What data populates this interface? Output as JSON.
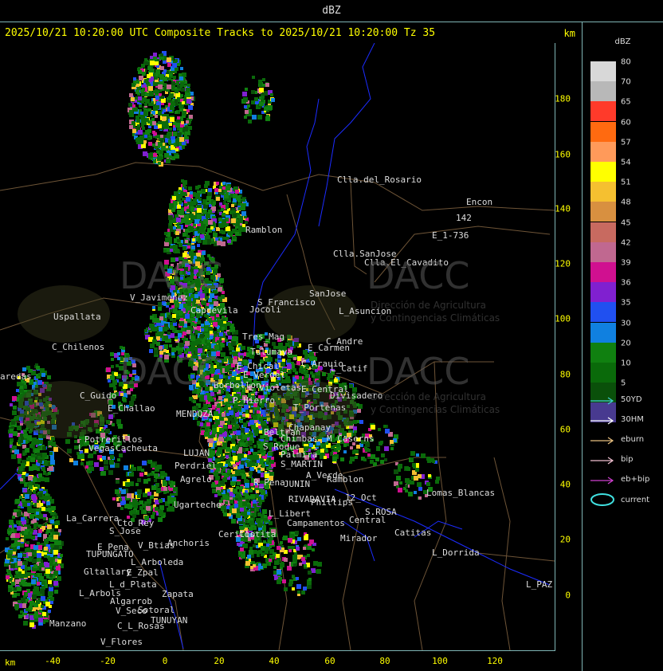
{
  "title_bar": "dBZ",
  "header": {
    "text": "2025/10/21 10:20:00 UTC Composite Tracks to 2025/10/21 10:20:00 Tz 35",
    "unit": "km"
  },
  "y_axis": {
    "unit": "km",
    "ticks": [
      "180",
      "160",
      "140",
      "120",
      "100",
      "80",
      "60",
      "40",
      "20",
      "0"
    ]
  },
  "x_axis": {
    "unit": "km",
    "ticks": [
      "-40",
      "-20",
      "0",
      "20",
      "40",
      "60",
      "80",
      "100",
      "120"
    ]
  },
  "legend": {
    "title": "dBZ",
    "levels": [
      {
        "label": "80",
        "color": "#d8d8d8"
      },
      {
        "label": "70",
        "color": "#b8b8b8"
      },
      {
        "label": "65",
        "color": "#ff3a2a"
      },
      {
        "label": "60",
        "color": "#ff6a10"
      },
      {
        "label": "57",
        "color": "#ff9a5a"
      },
      {
        "label": "54",
        "color": "#ffff00"
      },
      {
        "label": "51",
        "color": "#f5c030"
      },
      {
        "label": "48",
        "color": "#d89040"
      },
      {
        "label": "45",
        "color": "#c86a60"
      },
      {
        "label": "42",
        "color": "#c06890"
      },
      {
        "label": "39",
        "color": "#d01090"
      },
      {
        "label": "36",
        "color": "#8020d0"
      },
      {
        "label": "35",
        "color": "#2050f0"
      },
      {
        "label": "30",
        "color": "#1080e0"
      },
      {
        "label": "20",
        "color": "#108010"
      },
      {
        "label": "10",
        "color": "#0a6a0a"
      },
      {
        "label": "5",
        "color": "#0a500a"
      },
      {
        "label": "",
        "color": "#483a90"
      }
    ],
    "tracks": [
      {
        "label": "50YD",
        "color": "#40d0d0"
      },
      {
        "label": "30HM",
        "color": "#ffffff"
      },
      {
        "label": "eburn",
        "color": "#e8c080"
      },
      {
        "label": "bip",
        "color": "#f0c0d0"
      },
      {
        "label": "eb+bip",
        "color": "#d040d0"
      }
    ],
    "current_label": "current",
    "current_color": "#40e0e0"
  },
  "watermark": {
    "brand": "DACC",
    "line1": "Dirección de Agricultura",
    "line2": "y Contingencias Climáticas"
  },
  "places": [
    {
      "name": "Clla.del_Rosario"
    },
    {
      "name": "Encon"
    },
    {
      "name": "142"
    },
    {
      "name": "E_1-736"
    },
    {
      "name": "Ramblon"
    },
    {
      "name": "Clla.SanJose"
    },
    {
      "name": "Clla.El_Cavadito"
    },
    {
      "name": "Uspallata"
    },
    {
      "name": "V_Javimenez"
    },
    {
      "name": "Capdevila"
    },
    {
      "name": "S_Francisco"
    },
    {
      "name": "SanJose"
    },
    {
      "name": "L_Asuncion"
    },
    {
      "name": "C_Chilenos"
    },
    {
      "name": "Tres_Mag"
    },
    {
      "name": "Jocoli"
    },
    {
      "name": "Tulumaya"
    },
    {
      "name": "C_Andre"
    },
    {
      "name": "E_Carmen"
    },
    {
      "name": "E_Chical"
    },
    {
      "name": "E_Vergel"
    },
    {
      "name": "C_Arauio"
    },
    {
      "name": "L_Catif"
    },
    {
      "name": "aredas"
    },
    {
      "name": "Borbollon"
    },
    {
      "name": "L_Violetas"
    },
    {
      "name": "E_Central"
    },
    {
      "name": "Divisadero"
    },
    {
      "name": "C_Guido"
    },
    {
      "name": "P_Hierro"
    },
    {
      "name": "E_Challao"
    },
    {
      "name": "MENDOZA"
    },
    {
      "name": "T_Portenas"
    },
    {
      "name": "Chapanay"
    },
    {
      "name": "Beltran"
    },
    {
      "name": "Chimbas"
    },
    {
      "name": "M_Caserns"
    },
    {
      "name": "Potrerillos"
    },
    {
      "name": "Cacheuta"
    },
    {
      "name": "L_Vegas"
    },
    {
      "name": "LUJAN"
    },
    {
      "name": "S_Roque"
    },
    {
      "name": "Palmira"
    },
    {
      "name": "Perdriel"
    },
    {
      "name": "S_MARTIN"
    },
    {
      "name": "Agrelo"
    },
    {
      "name": "A_Verde"
    },
    {
      "name": "Ramblon"
    },
    {
      "name": "R_Pena"
    },
    {
      "name": "JUNIN"
    },
    {
      "name": "Lomas_Blancas"
    },
    {
      "name": "Ugarteche"
    },
    {
      "name": "RIVADAVIA"
    },
    {
      "name": "Phillips"
    },
    {
      "name": "12_Oct"
    },
    {
      "name": "L_Libert"
    },
    {
      "name": "S.ROSA"
    },
    {
      "name": "La_Carrera"
    },
    {
      "name": "Cto_Rey"
    },
    {
      "name": "Campamentos"
    },
    {
      "name": "Central"
    },
    {
      "name": "Catitas"
    },
    {
      "name": "S_Jose"
    },
    {
      "name": "Anchoris"
    },
    {
      "name": "Cerillo"
    },
    {
      "name": "E_Pena"
    },
    {
      "name": "V_Btias"
    },
    {
      "name": "Mirador"
    },
    {
      "name": "TUPUNGATO"
    },
    {
      "name": "L_Dorrida"
    },
    {
      "name": "L_Arboleda"
    },
    {
      "name": "Gltallary"
    },
    {
      "name": "E_Zpal"
    },
    {
      "name": "L_d_Plata"
    },
    {
      "name": "L_Arbols"
    },
    {
      "name": "Zapata"
    },
    {
      "name": "Algarrob"
    },
    {
      "name": "Sotoral"
    },
    {
      "name": "V_Seco"
    },
    {
      "name": "Manzano"
    },
    {
      "name": "TUNUYAN"
    },
    {
      "name": "C_L_Rosas"
    },
    {
      "name": "V_Flores"
    },
    {
      "name": "L_PAZ"
    },
    {
      "name": "Costita"
    }
  ]
}
